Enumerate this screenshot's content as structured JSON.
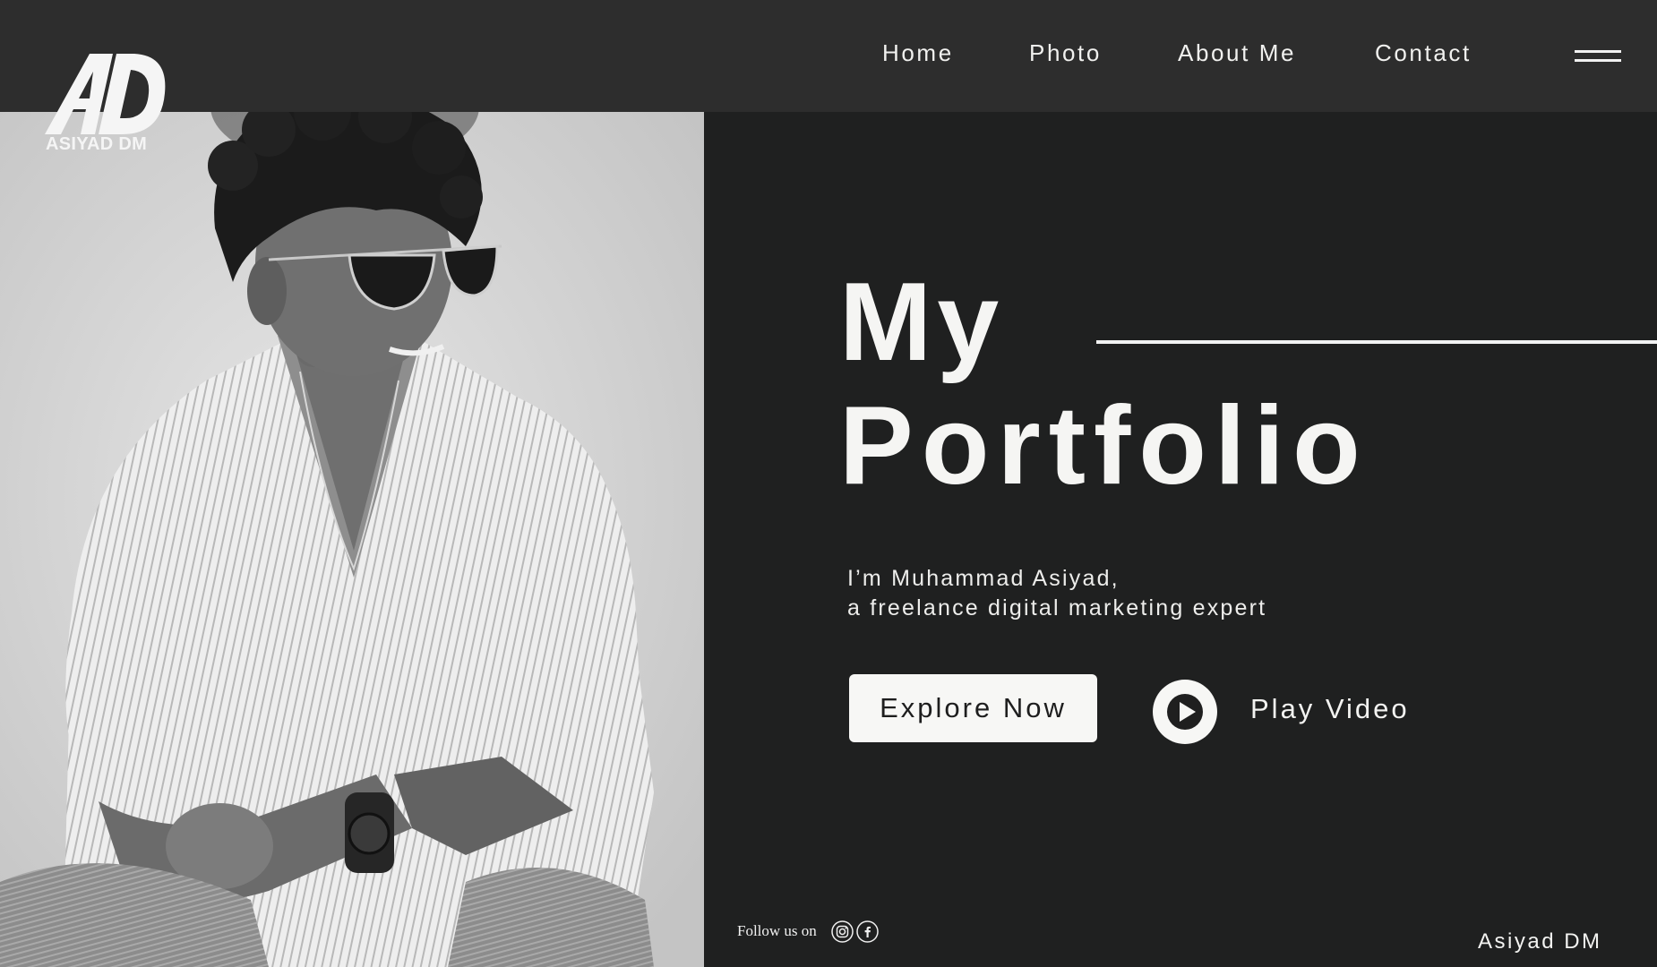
{
  "nav": {
    "items": [
      {
        "label": "Home"
      },
      {
        "label": "Photo"
      },
      {
        "label": "About Me"
      },
      {
        "label": "Contact"
      }
    ],
    "menu_icon": "hamburger-menu-icon"
  },
  "logo": {
    "monogram": "AD",
    "wordmark": "ASIYAD DM"
  },
  "hero": {
    "title_line1": "My",
    "title_line2": "Portfolio",
    "intro_line1": "I’m Muhammad Asiyad,",
    "intro_line2": "a freelance digital marketing expert"
  },
  "actions": {
    "explore_label": "Explore Now",
    "play_label": "Play Video",
    "play_icon": "play-circle-icon"
  },
  "footer": {
    "follow_text": "Follow us on",
    "social_icons": [
      "instagram-icon",
      "facebook-icon"
    ],
    "brand": "Asiyad DM"
  },
  "colors": {
    "topbar": "#2d2d2d",
    "background": "#1f2020",
    "photo_backdrop": "#d2d2d2",
    "text": "#f4f4f2",
    "button_bg": "#f7f7f5",
    "button_text": "#1e1e1e"
  }
}
